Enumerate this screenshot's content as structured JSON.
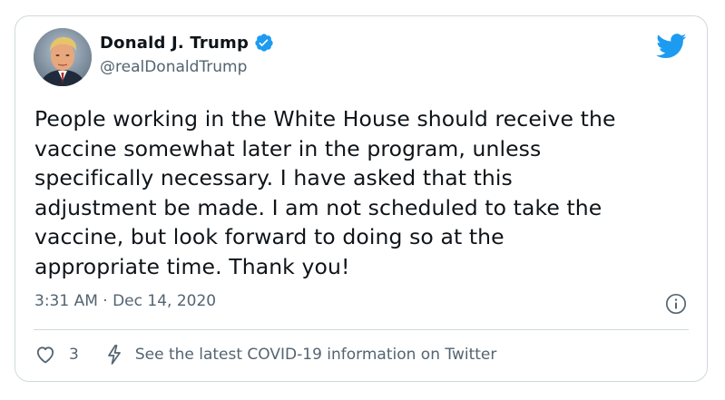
{
  "author": {
    "display_name": "Donald J. Trump",
    "handle": "@realDonaldTrump",
    "verified": true,
    "avatar_icon": "profile-photo"
  },
  "tweet": {
    "text": "People working in the White House should receive the\nvaccine somewhat later in the program, unless\nspecifically necessary. I have asked that this\nadjustment be made. I am not scheduled to take the\nvaccine, but look forward to doing so at the\nappropriate time. Thank you!",
    "timestamp": "3:31 AM · Dec 14, 2020"
  },
  "actions": {
    "like_count": "3",
    "covid_label": "See the latest COVID-19 information on Twitter"
  },
  "icons": {
    "brand": "twitter-bird-icon",
    "verified": "verified-badge-icon",
    "info": "info-icon",
    "like": "heart-icon",
    "covid": "lightning-bolt-icon"
  },
  "colors": {
    "brand_blue": "#1d9bf0",
    "text": "#0f1419",
    "secondary_text": "#536471",
    "border": "#cfd9de"
  }
}
